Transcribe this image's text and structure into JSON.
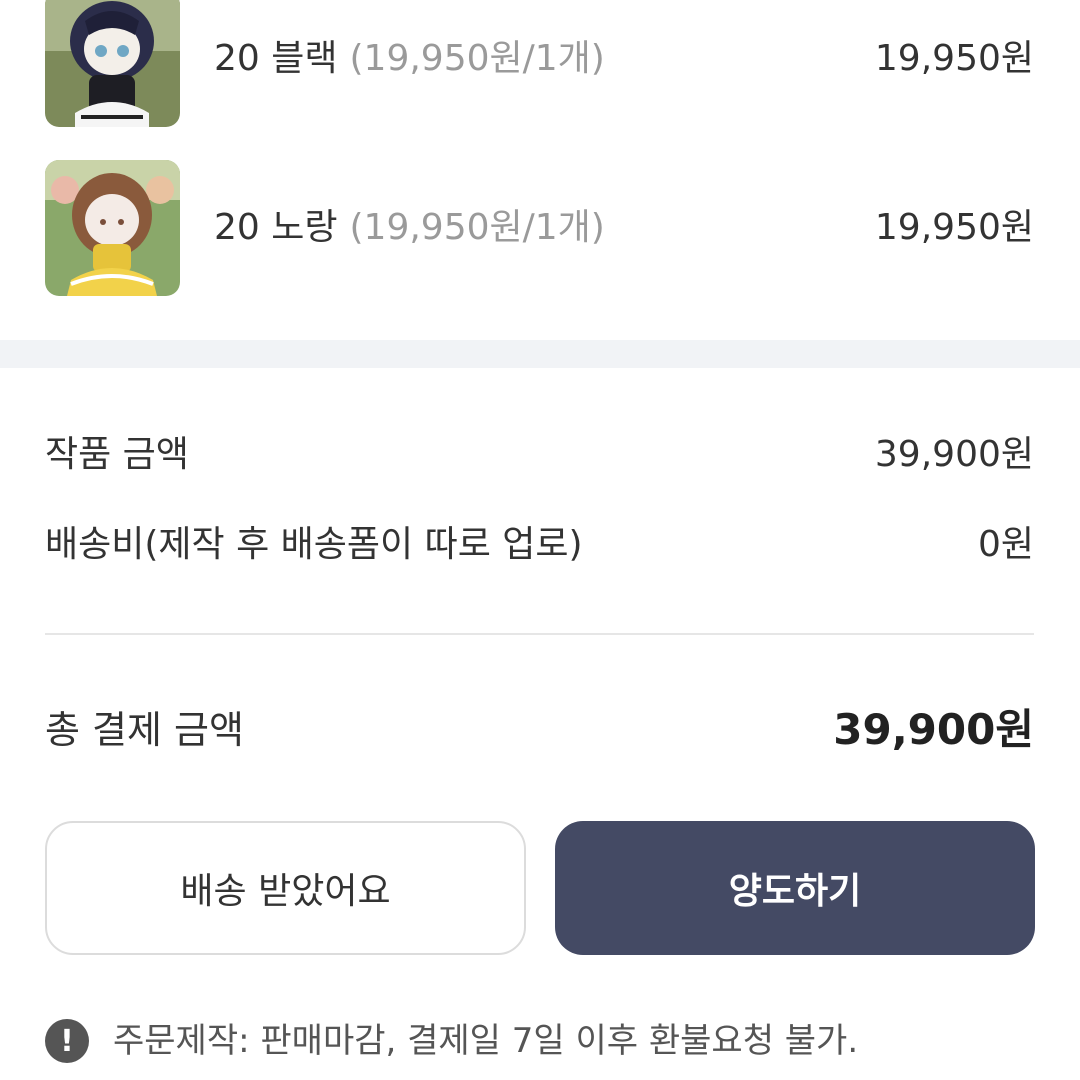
{
  "items": [
    {
      "name": "20 블랙",
      "unit_price": "(19,950원/1개)",
      "price": "19,950원",
      "thumb_icon": "doll-black-outfit"
    },
    {
      "name": "20 노랑",
      "unit_price": "(19,950원/1개)",
      "price": "19,950원",
      "thumb_icon": "doll-yellow-outfit"
    }
  ],
  "summary": {
    "product_label": "작품 금액",
    "product_value": "39,900원",
    "shipping_label": "배송비(제작 후 배송폼이 따로 업로)",
    "shipping_value": "0원",
    "total_label": "총 결제 금액",
    "total_value": "39,900원"
  },
  "buttons": {
    "received": "배송 받았어요",
    "transfer": "양도하기"
  },
  "notice": {
    "icon": "!",
    "text": "주문제작: 판매마감, 결제일 7일 이후 환불요청 불가."
  },
  "colors": {
    "primary_button": "#444a64",
    "band": "#f1f3f6",
    "muted_text": "#9a9a9a"
  }
}
